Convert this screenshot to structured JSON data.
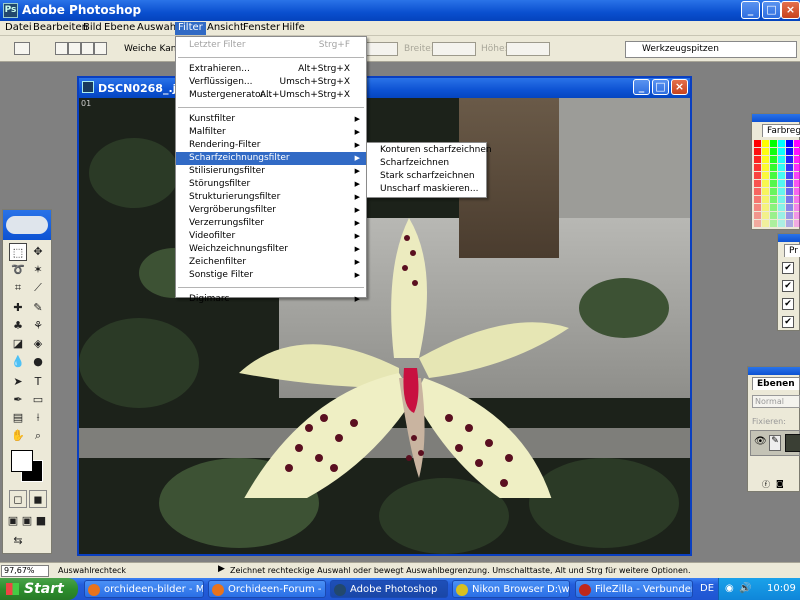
{
  "app": {
    "title": "Adobe Photoshop",
    "icon": "photoshop-icon",
    "window_controls": [
      "_",
      "□",
      "×"
    ]
  },
  "menubar": [
    "Datei",
    "Bearbeiten",
    "Bild",
    "Ebene",
    "Auswahl",
    "Filter",
    "Ansicht",
    "Fenster",
    "Hilfe"
  ],
  "options": {
    "weiche_kante_label": "Weiche Kante:",
    "breite_label": "Breite:",
    "hoehe_label": "Höhe:",
    "palette_tab": "Werkzeugspitzen"
  },
  "document": {
    "title": "DSCN0268_.jpg",
    "ruler": "01"
  },
  "filter_menu": {
    "groups": [
      [
        {
          "label": "Letzter Filter",
          "shortcut": "Strg+F",
          "disabled": true
        }
      ],
      [
        {
          "label": "Extrahieren...",
          "shortcut": "Alt+Strg+X"
        },
        {
          "label": "Verflüssigen...",
          "shortcut": "Umsch+Strg+X"
        },
        {
          "label": "Mustergenerator...",
          "shortcut": "Alt+Umsch+Strg+X"
        }
      ],
      [
        {
          "label": "Kunstfilter",
          "sub": true
        },
        {
          "label": "Malfilter",
          "sub": true
        },
        {
          "label": "Rendering-Filter",
          "sub": true
        },
        {
          "label": "Scharfzeichnungsfilter",
          "sub": true,
          "highlighted": true
        },
        {
          "label": "Stilisierungsfilter",
          "sub": true
        },
        {
          "label": "Störungsfilter",
          "sub": true
        },
        {
          "label": "Strukturierungsfilter",
          "sub": true
        },
        {
          "label": "Vergröberungsfilter",
          "sub": true
        },
        {
          "label": "Verzerrungsfilter",
          "sub": true
        },
        {
          "label": "Videofilter",
          "sub": true
        },
        {
          "label": "Weichzeichnungsfilter",
          "sub": true
        },
        {
          "label": "Zeichenfilter",
          "sub": true
        },
        {
          "label": "Sonstige Filter",
          "sub": true
        }
      ],
      [
        {
          "label": "Digimarc",
          "sub": true
        }
      ]
    ]
  },
  "submenu": [
    "Konturen scharfzeichnen",
    "Scharfzeichnen",
    "Stark scharfzeichnen",
    "Unscharf maskieren..."
  ],
  "palettes": {
    "color": "Farbregler",
    "layers": "Ebenen",
    "layers_mode": "Normal",
    "layers_fix": "Fixieren:",
    "history_tab": "Pr"
  },
  "status": {
    "zoom": "97,67%",
    "tool": "Auswahlrechteck",
    "hint": "Zeichnet rechteckige Auswahl oder bewegt Auswahlbegrenzung. Umschalttaste, Alt und Strg für weitere Optionen."
  },
  "taskbar": {
    "start": "Start",
    "tasks": [
      {
        "label": "orchideen-bilder - M...",
        "icon": "firefox-icon",
        "color": "#e8731c"
      },
      {
        "label": "Orchideen-Forum - ...",
        "icon": "firefox-icon",
        "color": "#e8731c"
      },
      {
        "label": "Adobe Photoshop",
        "icon": "photoshop-icon",
        "color": "#22486e"
      },
      {
        "label": "Nikon Browser D:\\wi...",
        "icon": "nikon-icon",
        "color": "#d8c020"
      },
      {
        "label": "FileZilla - Verbunden ...",
        "icon": "filezilla-icon",
        "color": "#c0281c"
      }
    ],
    "lang": "DE",
    "clock": "10:09"
  }
}
